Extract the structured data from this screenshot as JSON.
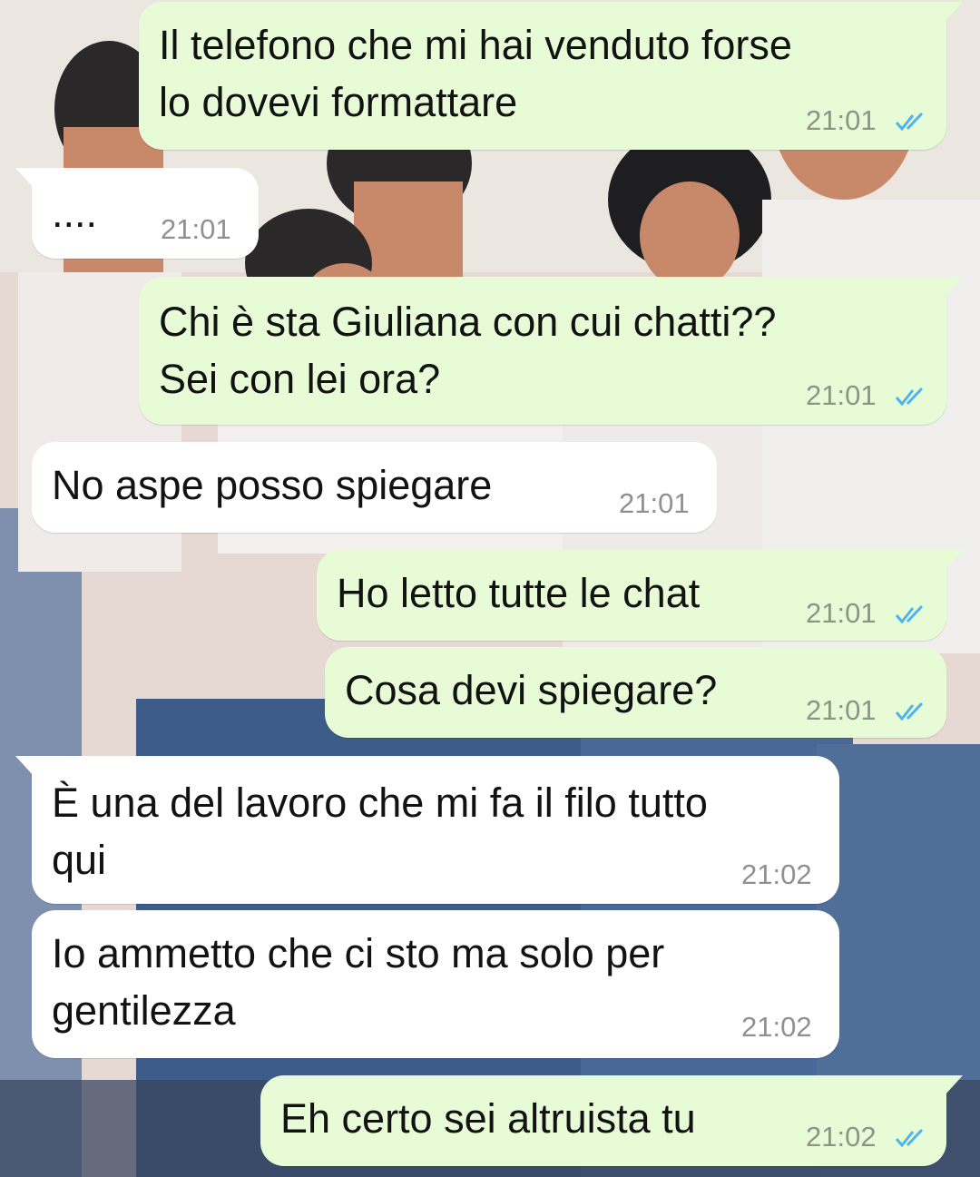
{
  "colors": {
    "outgoing_bubble": "#e7fcd6",
    "incoming_bubble": "#ffffff",
    "read_ticks": "#4fb4ec",
    "timestamp": "#8c9486"
  },
  "messages": [
    {
      "direction": "outgoing",
      "lines": [
        "Il telefono che mi hai venduto forse",
        "lo dovevi formattare"
      ],
      "time": "21:01",
      "status_icon": "double-check-read-icon"
    },
    {
      "direction": "incoming",
      "lines": [
        "...."
      ],
      "time": "21:01"
    },
    {
      "direction": "outgoing",
      "lines": [
        "Chi è sta Giuliana con cui chatti??",
        "Sei con lei ora?"
      ],
      "time": "21:01",
      "status_icon": "double-check-read-icon"
    },
    {
      "direction": "incoming",
      "lines": [
        "No aspe posso spiegare"
      ],
      "time": "21:01"
    },
    {
      "direction": "outgoing",
      "lines": [
        "Ho letto tutte le chat"
      ],
      "time": "21:01",
      "status_icon": "double-check-read-icon"
    },
    {
      "direction": "outgoing",
      "lines": [
        "Cosa devi spiegare?"
      ],
      "time": "21:01",
      "status_icon": "double-check-read-icon"
    },
    {
      "direction": "incoming",
      "lines": [
        "È una del lavoro che mi fa il filo tutto",
        "qui"
      ],
      "time": "21:02"
    },
    {
      "direction": "incoming",
      "lines": [
        "Io ammetto che ci sto ma solo per",
        "gentilezza"
      ],
      "time": "21:02"
    },
    {
      "direction": "outgoing",
      "lines": [
        "Eh certo sei altruista tu"
      ],
      "time": "21:02",
      "status_icon": "double-check-read-icon"
    }
  ]
}
